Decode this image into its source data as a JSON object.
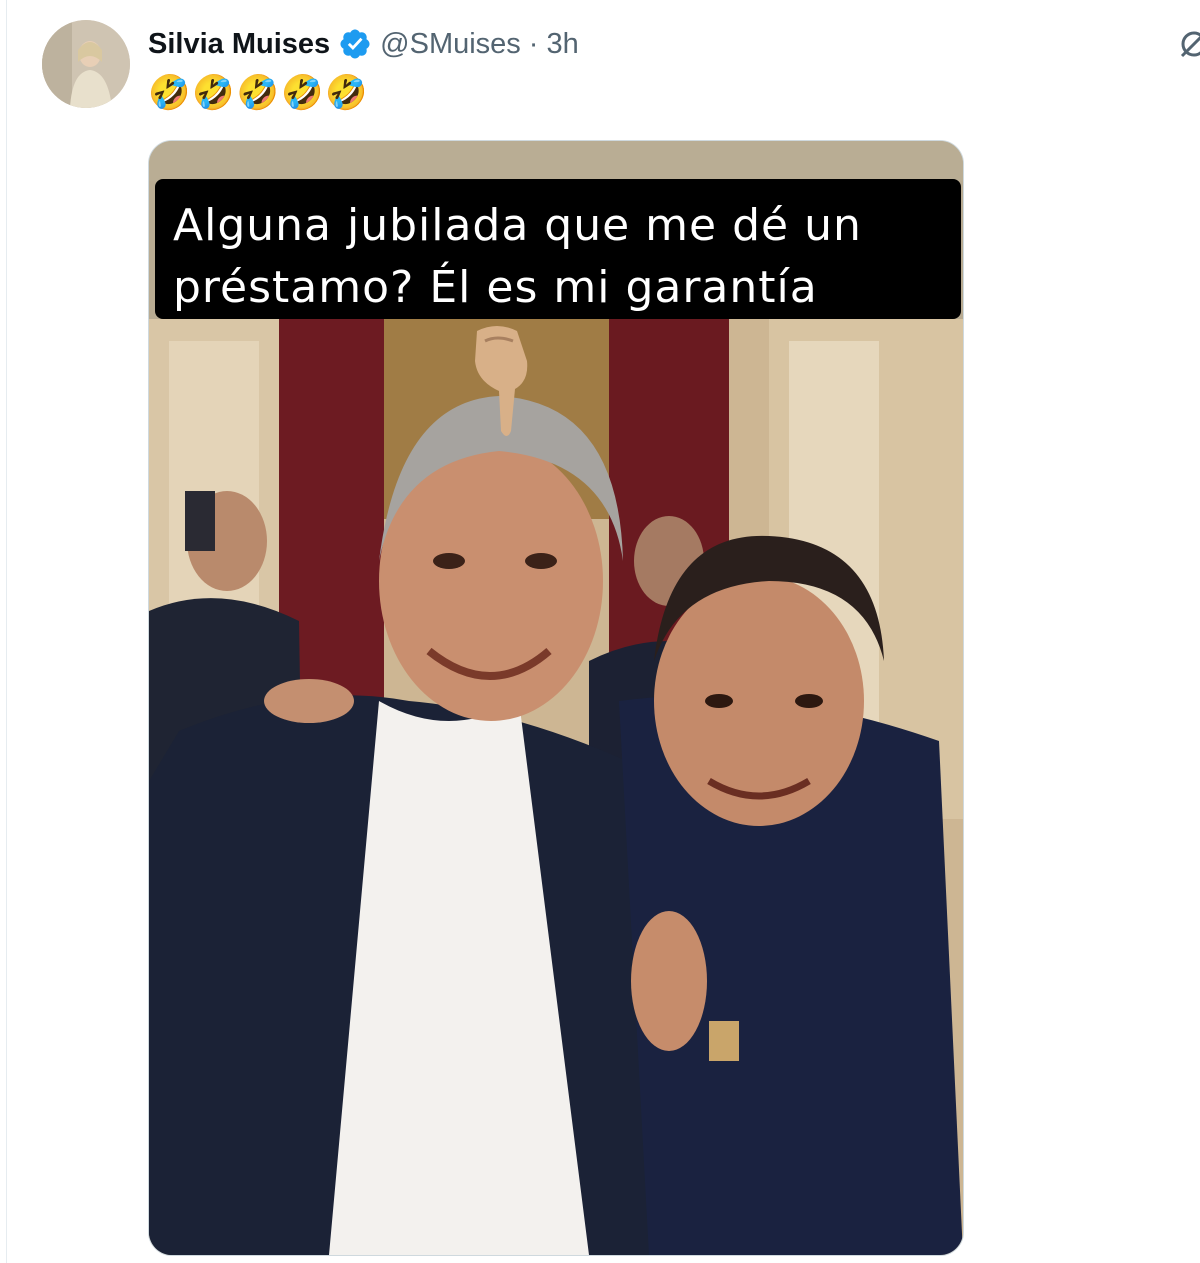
{
  "tweet": {
    "display_name": "Silvia Muises",
    "handle": "@SMuises",
    "separator": "·",
    "time": "3h",
    "text": "🤣🤣🤣🤣🤣",
    "verified": true,
    "verified_color": "#1d9bf0"
  },
  "media": {
    "caption": "Alguna jubilada que me dé un préstamo? Él es mi garantía",
    "pointer_emoji": "👇"
  },
  "icons": {
    "verified": "verified-badge-icon",
    "grok": "grok-icon"
  }
}
